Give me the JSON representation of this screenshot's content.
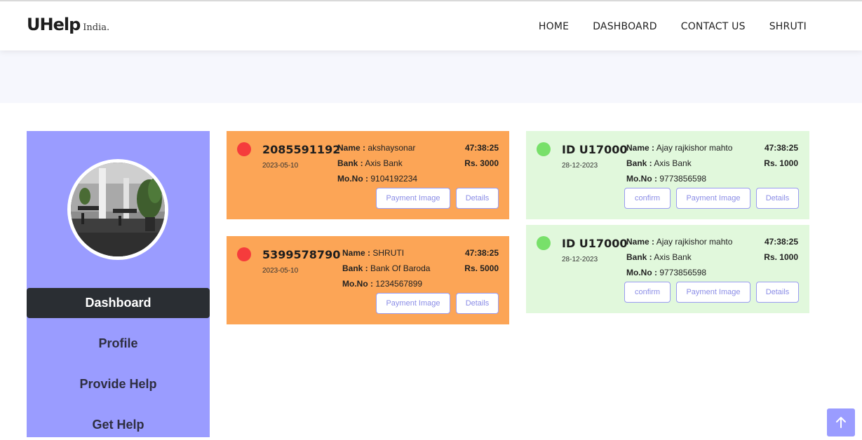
{
  "header": {
    "logo_main": "UHelp",
    "logo_sub": "India.",
    "nav": [
      "HOME",
      "DASHBOARD",
      "CONTACT US",
      "SHRUTI"
    ]
  },
  "sidebar": {
    "items": [
      {
        "label": "Dashboard",
        "active": true
      },
      {
        "label": "Profile",
        "active": false
      },
      {
        "label": "Provide Help",
        "active": false
      },
      {
        "label": "Get Help",
        "active": false
      }
    ]
  },
  "left_cards": [
    {
      "id": "2085591192",
      "date": "2023-05-10",
      "name_label": "Name :",
      "name": "akshaysonar",
      "bank_label": "Bank :",
      "bank": "Axis Bank",
      "mobile_label": "Mo.No :",
      "mobile": "9104192234",
      "timer": "47:38:25",
      "amount": "Rs. 3000",
      "buttons": [
        "Payment Image",
        "Details"
      ]
    },
    {
      "id": "5399578790",
      "date": "2023-05-10",
      "name_label": "Name :",
      "name": "SHRUTI",
      "bank_label": "Bank :",
      "bank": "Bank Of Baroda",
      "mobile_label": "Mo.No :",
      "mobile": "1234567899",
      "timer": "47:38:25",
      "amount": "Rs. 5000",
      "buttons": [
        "Payment Image",
        "Details"
      ]
    }
  ],
  "right_cards": [
    {
      "id": "ID U17000",
      "date": "28-12-2023",
      "name_label": "Name :",
      "name": "Ajay rajkishor mahto",
      "bank_label": "Bank :",
      "bank": "Axis Bank",
      "mobile_label": "Mo.No :",
      "mobile": "9773856598",
      "timer": "47:38:25",
      "amount": "Rs. 1000",
      "buttons": [
        "confirm",
        "Payment Image",
        "Details"
      ]
    },
    {
      "id": "ID U17000",
      "date": "28-12-2023",
      "name_label": "Name :",
      "name": "Ajay rajkishor mahto",
      "bank_label": "Bank :",
      "bank": "Axis Bank",
      "mobile_label": "Mo.No :",
      "mobile": "9773856598",
      "timer": "47:38:25",
      "amount": "Rs. 1000",
      "buttons": [
        "confirm",
        "Payment Image",
        "Details"
      ]
    }
  ],
  "colors": {
    "sidebar": "#9a9cff",
    "pending_card": "#fca556",
    "confirmed_card": "#e1f8dc",
    "pending_dot": "#f53c3c",
    "confirmed_dot": "#78e06a"
  },
  "icons": {
    "scroll_top": "arrow-up-icon"
  }
}
